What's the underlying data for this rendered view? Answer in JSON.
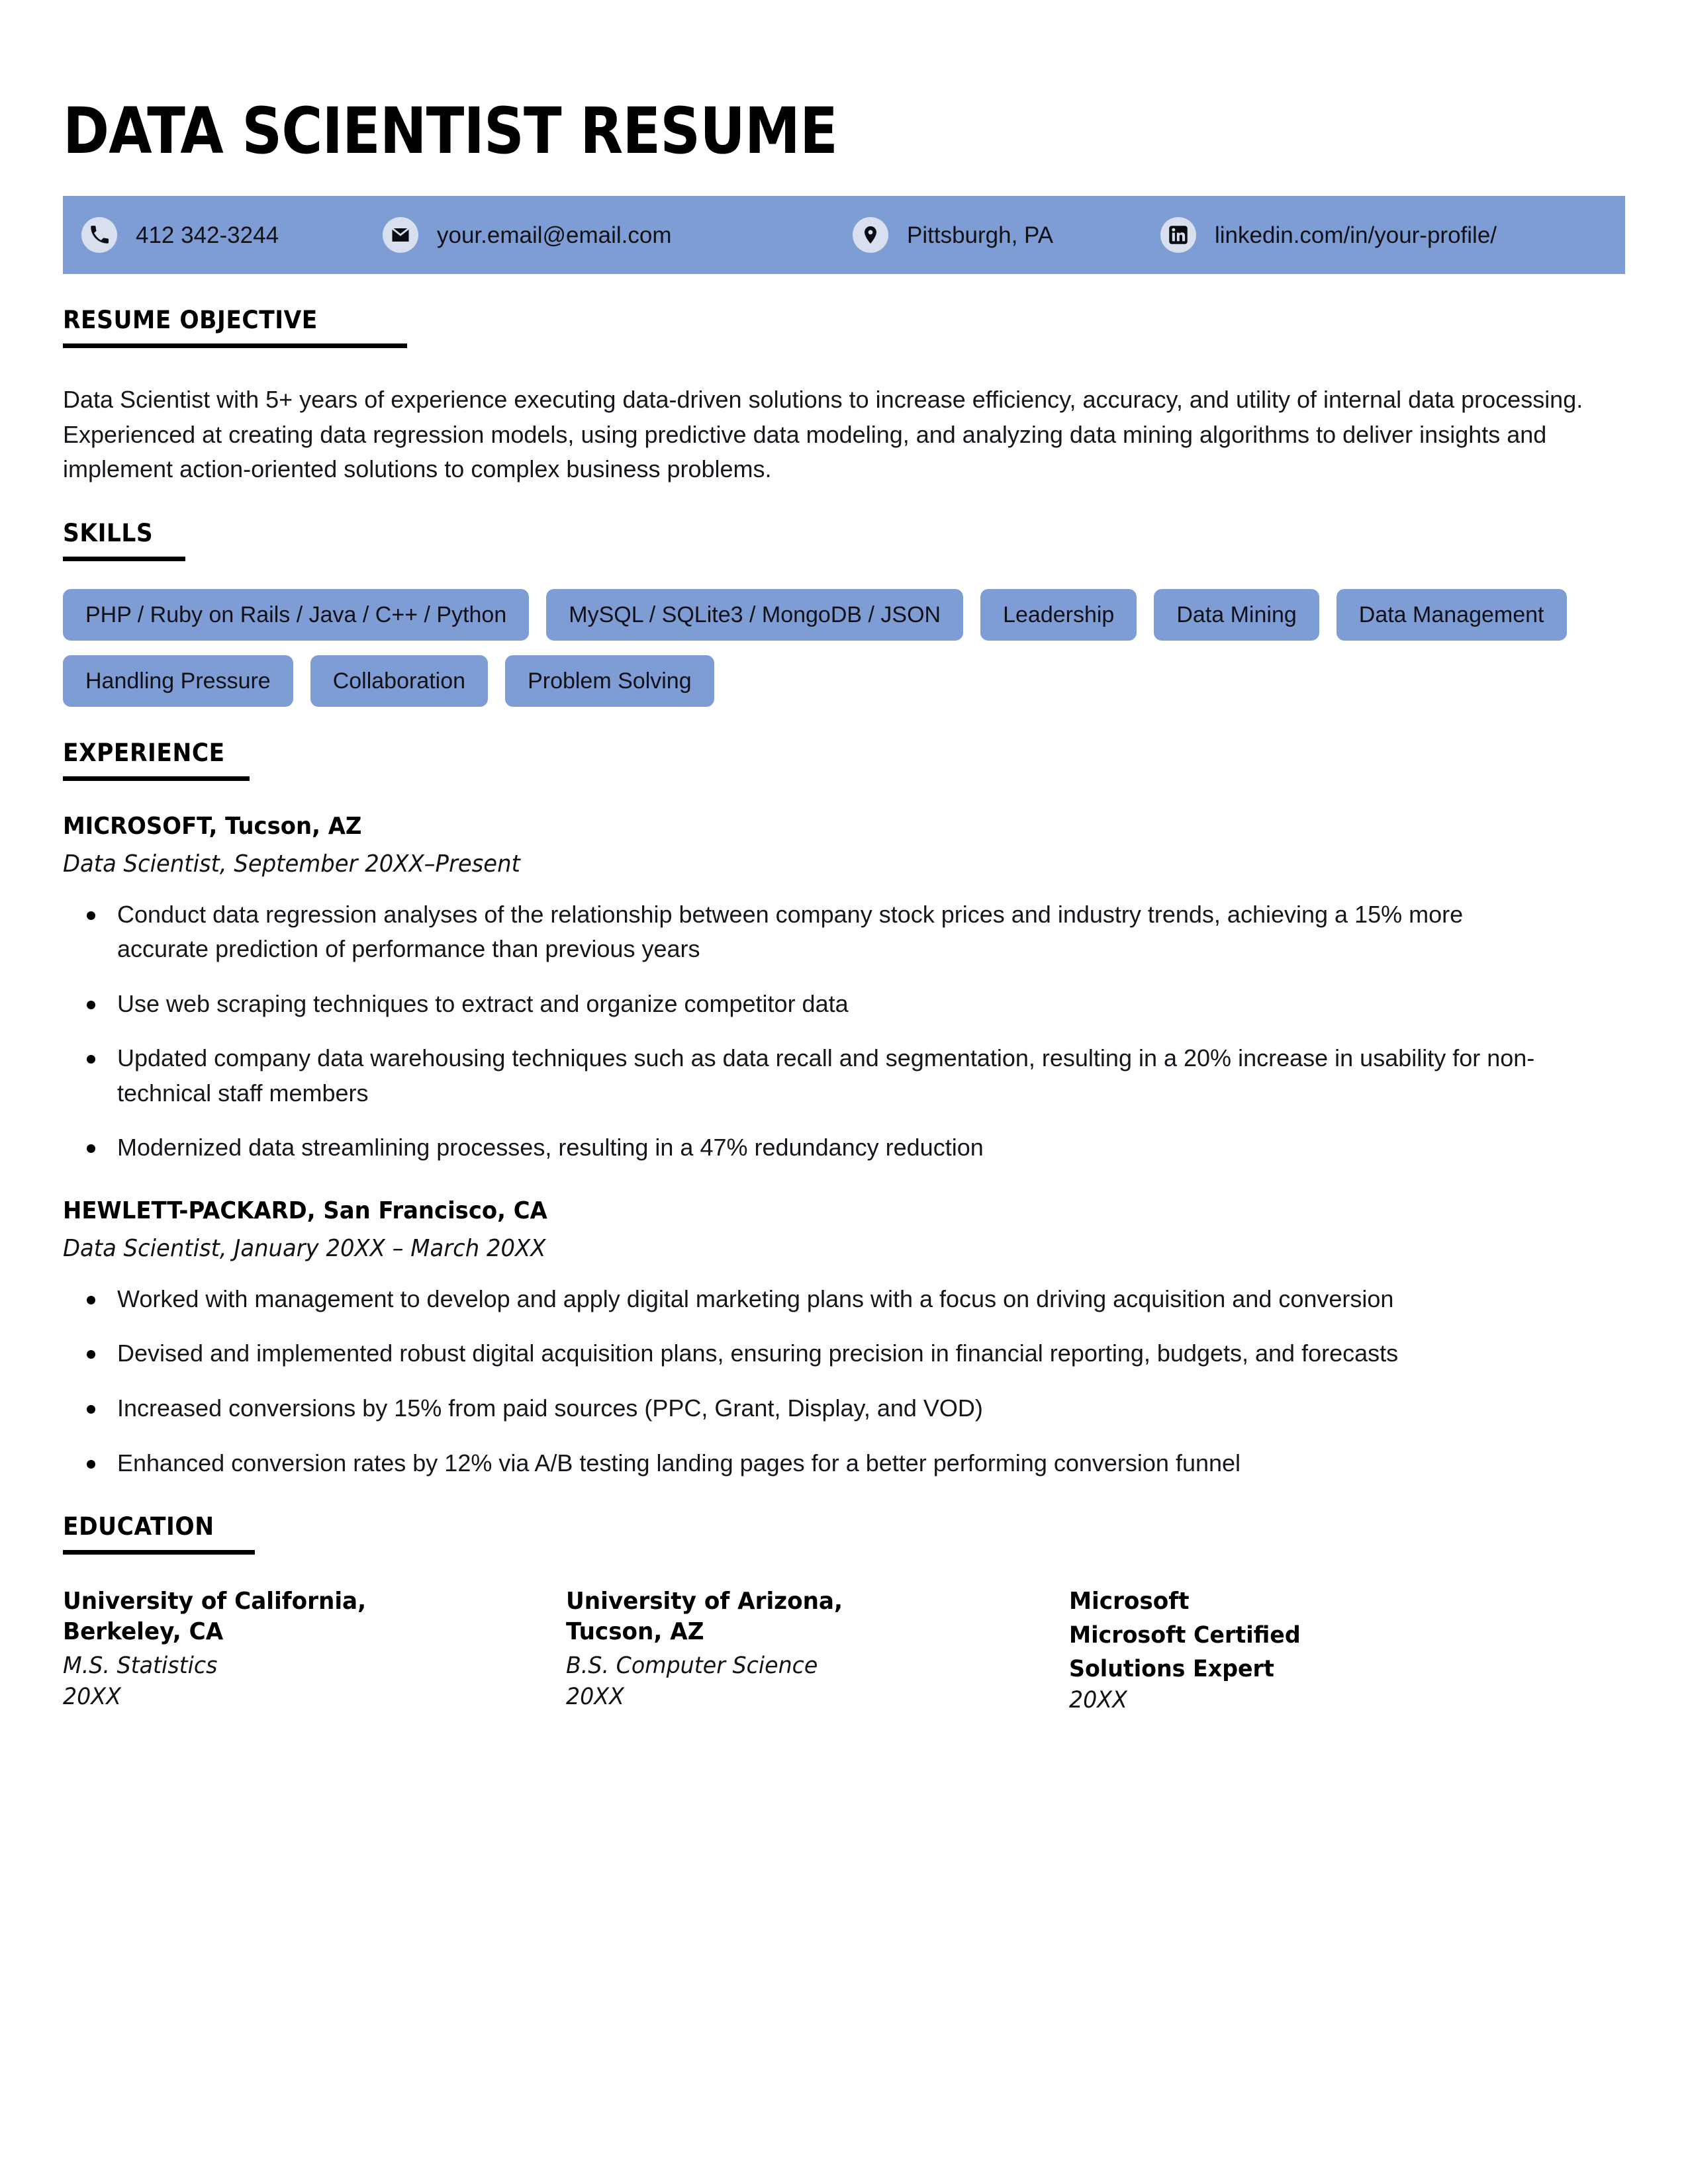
{
  "document": {
    "title": "DATA SCIENTIST RESUME",
    "accent_color": "#7E9DD4",
    "icon_bg_color": "#D8E0F0",
    "text_color": "#15151C"
  },
  "contact": {
    "items": [
      {
        "icon": "phone-icon",
        "text": "412 342-3244"
      },
      {
        "icon": "envelope-icon",
        "text": "your.email@email.com"
      },
      {
        "icon": "map-pin-icon",
        "text": "Pittsburgh, PA"
      },
      {
        "icon": "linkedin-icon",
        "text": "linkedin.com/in/your-profile/"
      }
    ]
  },
  "objective": {
    "heading": "RESUME OBJECTIVE",
    "body": "Data Scientist with 5+ years of experience executing data-driven solutions to increase efficiency, accuracy, and utility of internal data processing. Experienced at creating data regression models, using predictive data modeling, and analyzing data mining algorithms to deliver insights and implement action-oriented solutions to complex business problems."
  },
  "skills": {
    "heading": "SKILLS",
    "tags": [
      "PHP / Ruby on Rails / Java / C++ / Python",
      "MySQL / SQLite3 / MongoDB / JSON",
      "Leadership",
      "Data Mining",
      "Data Management",
      "Handling Pressure",
      "Collaboration",
      "Problem Solving"
    ]
  },
  "experience": {
    "heading": "EXPERIENCE",
    "jobs": [
      {
        "company": "MICROSOFT, Tucson, AZ",
        "meta": "Data Scientist, September 20XX–Present",
        "bullets": [
          "Conduct data regression analyses of the relationship between company stock prices and industry trends, achieving a 15% more accurate prediction of performance than previous years",
          "Use web scraping techniques to extract and organize competitor data",
          "Updated company data warehousing techniques such as data recall and segmentation, resulting in a 20% increase in usability for non-technical staff members",
          "Modernized data streamlining processes, resulting in a 47% redundancy reduction"
        ]
      },
      {
        "company": "HEWLETT-PACKARD, San Francisco, CA",
        "meta": "Data Scientist, January 20XX – March 20XX",
        "bullets": [
          "Worked with management to develop and apply digital marketing plans with a focus on driving acquisition and conversion",
          "Devised and implemented robust digital acquisition plans, ensuring precision in financial reporting, budgets, and forecasts",
          "Increased conversions by 15% from paid sources (PPC, Grant, Display, and VOD)",
          "Enhanced conversion rates by 12% via A/B testing landing pages for a better performing conversion funnel"
        ]
      }
    ]
  },
  "education": {
    "heading": "EDUCATION",
    "entries": [
      {
        "school_line1": "University of California,",
        "school_line2": "Berkeley, CA",
        "degree_line1": "M.S. Statistics",
        "degree_line2": "",
        "degree_bold": false,
        "year": "20XX"
      },
      {
        "school_line1": "University of Arizona,",
        "school_line2": "Tucson, AZ",
        "degree_line1": "B.S. Computer Science",
        "degree_line2": "",
        "degree_bold": false,
        "year": "20XX"
      },
      {
        "school_line1": "Microsoft",
        "school_line2": "",
        "degree_line1": "Microsoft Certified",
        "degree_line2": "Solutions Expert",
        "degree_bold": true,
        "year": "20XX"
      }
    ]
  }
}
